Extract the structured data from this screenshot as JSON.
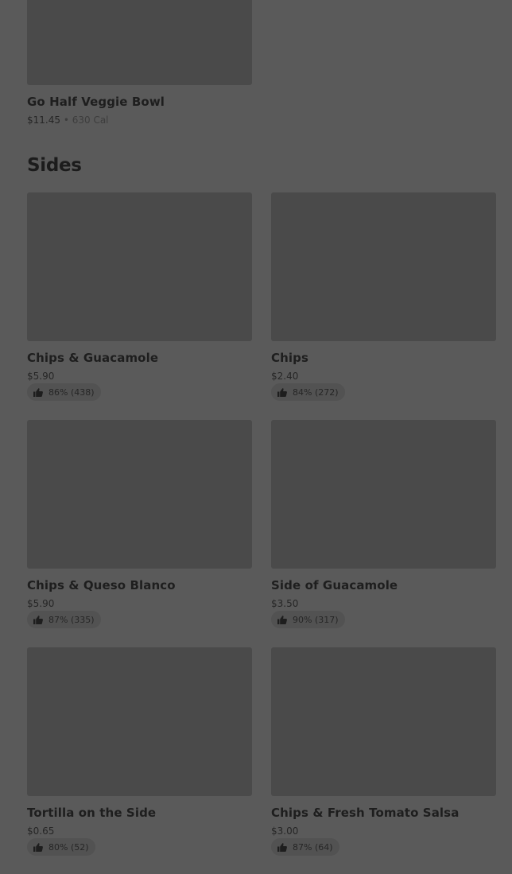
{
  "top_item": {
    "name": "Go Half Veggie Bowl",
    "price": "$11.45",
    "separator": "•",
    "calories": "630 Cal"
  },
  "sides": {
    "title": "Sides",
    "items": [
      {
        "name": "Chips & Guacamole",
        "price": "$5.90",
        "rating": "86% (438)",
        "icon": "thumbs-up-icon"
      },
      {
        "name": "Chips",
        "price": "$2.40",
        "rating": "84% (272)",
        "icon": "thumbs-up-icon"
      },
      {
        "name": "Chips & Queso Blanco",
        "price": "$5.90",
        "rating": "87% (335)",
        "icon": "thumbs-up-icon"
      },
      {
        "name": "Side of Guacamole",
        "price": "$3.50",
        "rating": "90% (317)",
        "icon": "thumbs-up-icon"
      },
      {
        "name": "Tortilla on the Side",
        "price": "$0.65",
        "rating": "80% (52)",
        "icon": "thumbs-up-icon"
      },
      {
        "name": "Chips & Fresh Tomato Salsa",
        "price": "$3.00",
        "rating": "87% (64)",
        "icon": "thumbs-up-icon"
      }
    ]
  },
  "colors": {
    "overlay_bg": "#5a5a5a",
    "image_placeholder": "#4a4a4a",
    "text": "#1e1e1e"
  }
}
